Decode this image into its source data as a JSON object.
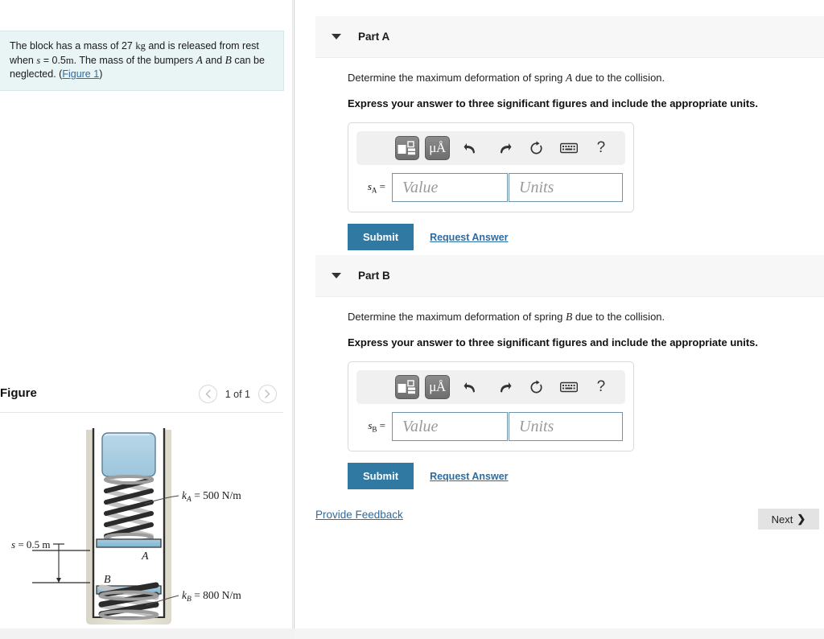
{
  "problem": {
    "text_parts": {
      "p1": "The block has a mass of 27",
      "mass_unit": "kg",
      "p2": "and is released from rest when",
      "var_s": "s",
      "p3": "= 0.5",
      "len_unit": "m",
      "p4": ". The mass of the bumpers",
      "var_a": "A",
      "p5": "and",
      "var_b": "B",
      "p6": "can be neglected. (",
      "figure_link": "Figure 1",
      "p7": ")"
    }
  },
  "figure": {
    "title": "Figure",
    "pager": {
      "prev_icon": "chevron-left-icon",
      "label": "1 of 1",
      "next_icon": "chevron-right-icon"
    },
    "labels": {
      "k_a": "k",
      "k_a_sub": "A",
      "k_a_value": "= 500 N/m",
      "k_b": "k",
      "k_b_sub": "B",
      "k_b_value": "= 800 N/m",
      "bumper_a": "A",
      "bumper_b": "B",
      "dim_s": "s = 0.5 m"
    },
    "colors": {
      "block_fill": "#a9ccdf",
      "bumper_fill": "#8ec0d8",
      "wall_fill": "#e8e6dc",
      "spring_dark": "#2b2b2b",
      "spring_light": "#c9c9c9"
    }
  },
  "parts": [
    {
      "id": "part-a",
      "caret_icon": "caret-down-icon",
      "title": "Part A",
      "question": "Determine the maximum deformation of spring A due to the collision.",
      "question_pre": "Determine the maximum deformation of spring",
      "question_var": "A",
      "question_post": "due to the collision.",
      "instruction": "Express your answer to three significant figures and include the appropriate units.",
      "answer": {
        "label_var": "s",
        "label_sub": "A",
        "label_eq": "=",
        "value_placeholder": "Value",
        "value": "",
        "units_placeholder": "Units",
        "units": "",
        "toolbar": [
          {
            "name": "template-math-icon",
            "label": ""
          },
          {
            "name": "units-micro-angstrom-icon",
            "label": "μÅ"
          },
          {
            "name": "undo-icon",
            "label": "↩"
          },
          {
            "name": "redo-icon",
            "label": "↪"
          },
          {
            "name": "reset-icon",
            "label": "↺"
          },
          {
            "name": "keyboard-icon",
            "label": ""
          },
          {
            "name": "help-icon",
            "label": "?"
          }
        ]
      },
      "submit_label": "Submit",
      "request_answer_label": "Request Answer"
    },
    {
      "id": "part-b",
      "caret_icon": "caret-down-icon",
      "title": "Part B",
      "question": "Determine the maximum deformation of spring B due to the collision.",
      "question_pre": "Determine the maximum deformation of spring",
      "question_var": "B",
      "question_post": "due to the collision.",
      "instruction": "Express your answer to three significant figures and include the appropriate units.",
      "answer": {
        "label_var": "s",
        "label_sub": "B",
        "label_eq": "=",
        "value_placeholder": "Value",
        "value": "",
        "units_placeholder": "Units",
        "units": "",
        "toolbar": [
          {
            "name": "template-math-icon",
            "label": ""
          },
          {
            "name": "units-micro-angstrom-icon",
            "label": "μÅ"
          },
          {
            "name": "undo-icon",
            "label": "↩"
          },
          {
            "name": "redo-icon",
            "label": "↪"
          },
          {
            "name": "reset-icon",
            "label": "↺"
          },
          {
            "name": "keyboard-icon",
            "label": ""
          },
          {
            "name": "help-icon",
            "label": "?"
          }
        ]
      },
      "submit_label": "Submit",
      "request_answer_label": "Request Answer"
    }
  ],
  "footer": {
    "feedback_label": "Provide Feedback",
    "next_label": "Next",
    "next_icon": "chevron-right-icon"
  },
  "theme": {
    "accent_blue": "#3079a2",
    "link_blue": "#2b6ca3",
    "prompt_bg": "#e9f4f5",
    "header_bg": "#f7f7f7",
    "next_bg": "#e3e3e3"
  }
}
